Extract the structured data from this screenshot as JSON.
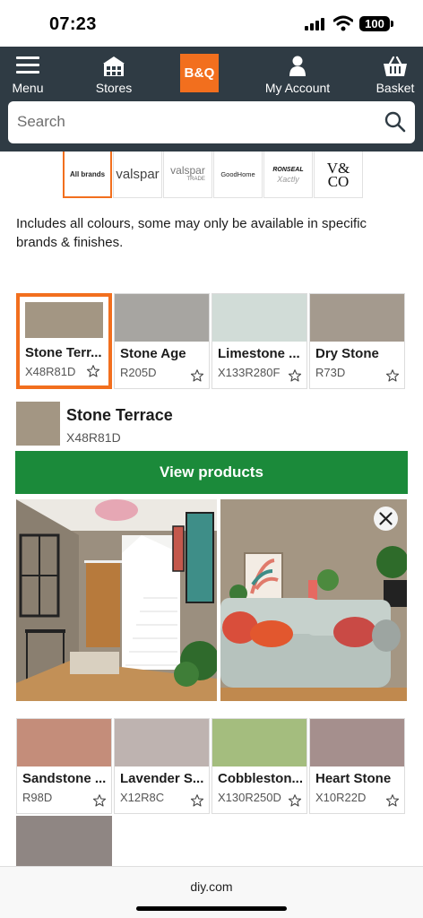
{
  "status": {
    "time": "07:23",
    "battery": "100"
  },
  "header": {
    "menu_label": "Menu",
    "stores_label": "Stores",
    "logo_text": "B&Q",
    "account_label": "My Account",
    "basket_label": "Basket"
  },
  "search": {
    "placeholder": "Search"
  },
  "brands": [
    {
      "label": "All brands"
    },
    {
      "label": "valspar"
    },
    {
      "label": "valspar",
      "sub": "TRADE"
    },
    {
      "label": "GoodHome"
    },
    {
      "label": "RONSEAL",
      "sub": "Xactly"
    },
    {
      "label": "V&",
      "sub": "CO"
    }
  ],
  "info_text": "Includes all colours, some may only be available in specific brands & finishes.",
  "colors": {
    "brand_orange": "#f26f1e",
    "header_bg": "#2f3b44",
    "button_green": "#1b8a3a"
  },
  "swatches_top": [
    {
      "name": "Stone Terr...",
      "code": "X48R81D",
      "color": "#a39683",
      "selected": true
    },
    {
      "name": "Stone Age",
      "code": "R205D",
      "color": "#a7a5a1"
    },
    {
      "name": "Limestone ...",
      "code": "X133R280F",
      "color": "#d1dcd7"
    },
    {
      "name": "Dry Stone",
      "code": "R73D",
      "color": "#a49a8e"
    }
  ],
  "selected": {
    "name": "Stone Terrace",
    "code": "X48R81D",
    "color": "#a39683",
    "button_label": "View products"
  },
  "swatches_bottom": [
    {
      "name": "Sandstone ...",
      "code": "R98D",
      "color": "#c48d7a"
    },
    {
      "name": "Lavender S...",
      "code": "X12R8C",
      "color": "#beb3b0"
    },
    {
      "name": "Cobbleston...",
      "code": "X130R250D",
      "color": "#a4bd7e"
    },
    {
      "name": "Heart Stone",
      "code": "X10R22D",
      "color": "#a58f8d"
    }
  ],
  "partial_swatch": {
    "color": "#8f8683"
  },
  "browser": {
    "url": "diy.com"
  }
}
